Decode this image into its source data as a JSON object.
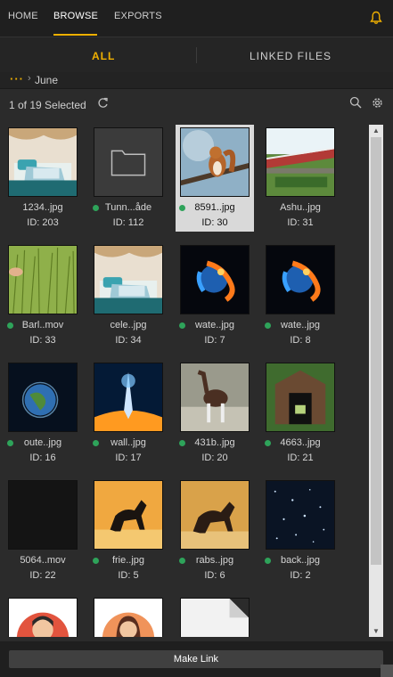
{
  "nav": {
    "tabs": [
      "HOME",
      "BROWSE",
      "EXPORTS"
    ],
    "active": "BROWSE",
    "accent": "#f0b000"
  },
  "subtabs": {
    "all": "ALL",
    "linked": "LINKED FILES"
  },
  "breadcrumb": {
    "ellipsis": "···",
    "separator": "›",
    "folder": "June"
  },
  "status": {
    "text": "1 of 19 Selected"
  },
  "files": [
    {
      "name": "1234..jpg",
      "id": "ID: 203",
      "dot": false,
      "thumb": "bed"
    },
    {
      "name": "Tunn...åde",
      "id": "ID: 112",
      "dot": true,
      "thumb": "folder"
    },
    {
      "name": "8591..jpg",
      "id": "ID: 30",
      "dot": true,
      "thumb": "squirrel",
      "selected": true
    },
    {
      "name": "Ashu..jpg",
      "id": "ID: 31",
      "dot": false,
      "thumb": "bridge"
    },
    {
      "name": "Barl..mov",
      "id": "ID: 33",
      "dot": true,
      "thumb": "grass"
    },
    {
      "name": "cele..jpg",
      "id": "ID: 34",
      "dot": false,
      "thumb": "bed"
    },
    {
      "name": "wate..jpg",
      "id": "ID: 7",
      "dot": true,
      "thumb": "fireplanet"
    },
    {
      "name": "wate..jpg",
      "id": "ID: 8",
      "dot": true,
      "thumb": "fireplanet"
    },
    {
      "name": "oute..jpg",
      "id": "ID: 16",
      "dot": true,
      "thumb": "earth"
    },
    {
      "name": "wall..jpg",
      "id": "ID: 17",
      "dot": true,
      "thumb": "burst"
    },
    {
      "name": "431b..jpg",
      "id": "ID: 20",
      "dot": true,
      "thumb": "okapi"
    },
    {
      "name": "4663..jpg",
      "id": "ID: 21",
      "dot": true,
      "thumb": "tunnel"
    },
    {
      "name": "5064..mov",
      "id": "ID: 22",
      "dot": false,
      "thumb": "dark"
    },
    {
      "name": "frie..jpg",
      "id": "ID: 5",
      "dot": true,
      "thumb": "horse"
    },
    {
      "name": "rabs..jpg",
      "id": "ID: 6",
      "dot": true,
      "thumb": "horse2"
    },
    {
      "name": "back..jpg",
      "id": "ID: 2",
      "dot": true,
      "thumb": "stars"
    },
    {
      "name": "",
      "id": "",
      "dot": false,
      "thumb": "avatar-man"
    },
    {
      "name": "",
      "id": "",
      "dot": false,
      "thumb": "avatar-woman"
    },
    {
      "name": "",
      "id": "",
      "dot": false,
      "thumb": "document"
    }
  ],
  "footer": {
    "make_link": "Make Link"
  }
}
